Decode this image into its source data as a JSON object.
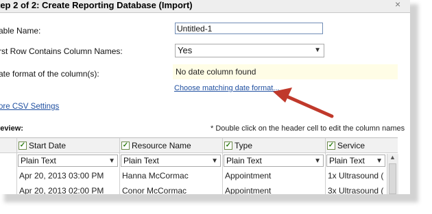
{
  "dialog": {
    "title": "tep 2 of 2: Create Reporting Database (Import)",
    "close_glyph": "×"
  },
  "form": {
    "table_name_label": "able Name:",
    "table_name_value": "Untitled-1",
    "first_row_label": "rst Row Contains Column Names:",
    "first_row_value": "Yes",
    "date_format_label": "ate format of the column(s):",
    "date_status": "No date column found",
    "choose_date_link": "Choose matching date format...",
    "csv_settings_link": "ore CSV Settings"
  },
  "preview": {
    "label": "review:",
    "note": "* Double click on the header cell to edit the column names",
    "columns": [
      {
        "name": "Start Date",
        "type": "Plain Text"
      },
      {
        "name": "Resource Name",
        "type": "Plain Text"
      },
      {
        "name": "Type",
        "type": "Plain Text"
      },
      {
        "name": "Service",
        "type": "Plain Text"
      }
    ],
    "rows": [
      [
        "Apr 20, 2013 03:00 PM",
        "Hanna McCormac",
        "Appointment",
        "1x Ultrasound ("
      ],
      [
        "Apr 20, 2013 02:00 PM",
        "Conor McCormac",
        "Appointment",
        "3x Ultrasound ("
      ]
    ]
  },
  "annotation": {
    "arrow_color": "#c0392b"
  }
}
